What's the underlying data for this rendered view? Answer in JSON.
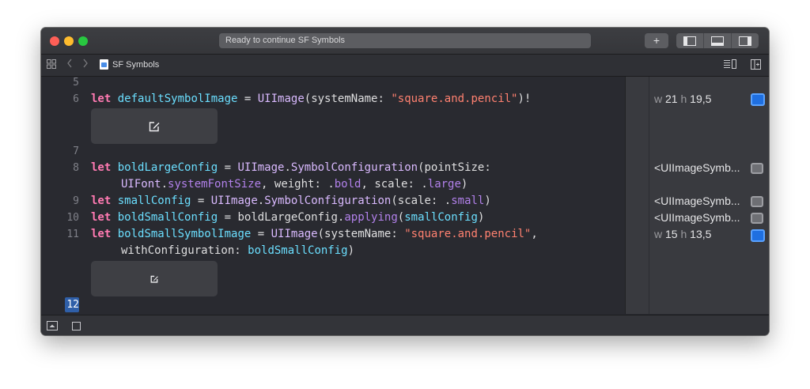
{
  "titlebar": {
    "activity_text": "Ready to continue SF Symbols",
    "plus_label": "+"
  },
  "pathbar": {
    "file_name": "SF Symbols"
  },
  "editor": {
    "line_numbers": [
      "5",
      "6",
      "7",
      "8",
      "9",
      "10",
      "11",
      "12"
    ],
    "current_line": "12",
    "code": {
      "l6": {
        "kw": "let",
        "name": "defaultSymbolImage",
        "eq": " = ",
        "type": "UIImage",
        "open": "(systemName: ",
        "str": "\"square.and.pencil\"",
        "close": ")!"
      },
      "l8": {
        "kw": "let",
        "name": "boldLargeConfig",
        "eq": " = ",
        "type": "UIImage",
        "dot": ".",
        "type2": "SymbolConfiguration",
        "rest": "(pointSize:"
      },
      "l8b": {
        "type": "UIFont",
        "dot": ".",
        "prop": "systemFontSize",
        "mid": ", weight: .",
        "bold": "bold",
        "mid2": ", scale: .",
        "large": "large",
        "close": ")"
      },
      "l9": {
        "kw": "let",
        "name": "smallConfig",
        "eq": " = ",
        "type": "UIImage",
        "dot": ".",
        "type2": "SymbolConfiguration",
        "mid": "(scale: .",
        "small": "small",
        "close": ")"
      },
      "l10": {
        "kw": "let",
        "name": "boldSmallConfig",
        "eq": " = ",
        "ref": "boldLargeConfig",
        "dot": ".",
        "method": "applying",
        "open": "(",
        "arg": "smallConfig",
        "close": ")"
      },
      "l11": {
        "kw": "let",
        "name": "boldSmallSymbolImage",
        "eq": " = ",
        "type": "UIImage",
        "open": "(systemName: ",
        "str": "\"square.and.pencil\"",
        "comma": ","
      },
      "l11b": {
        "label": "withConfiguration: ",
        "arg": "boldSmallConfig",
        "close": ")"
      }
    }
  },
  "results": {
    "r6": {
      "w_label": "w",
      "w": "21",
      "h_label": "h",
      "h": "19,5"
    },
    "r8": "<UIImageSymb...",
    "r9": "<UIImageSymb...",
    "r10": "<UIImageSymb...",
    "r11": {
      "w_label": "w",
      "w": "15",
      "h_label": "h",
      "h": "13,5"
    }
  },
  "colors": {
    "keyword": "#ff7ab2",
    "declaration": "#6bdfff",
    "type": "#dabaff",
    "string": "#ff8170",
    "other": "#b281eb",
    "editor_bg": "#292a30"
  },
  "icons": {
    "toolbar": [
      "plus-icon",
      "navigator-toggle-icon",
      "debug-area-toggle-icon",
      "inspector-toggle-icon"
    ],
    "pathbar": [
      "related-items-icon",
      "back-chevron-icon",
      "forward-chevron-icon",
      "playground-file-icon",
      "editor-options-icon",
      "add-editor-icon"
    ],
    "bottom": [
      "show-debug-area-icon",
      "stop-icon"
    ],
    "preview": "square-and-pencil-icon"
  }
}
